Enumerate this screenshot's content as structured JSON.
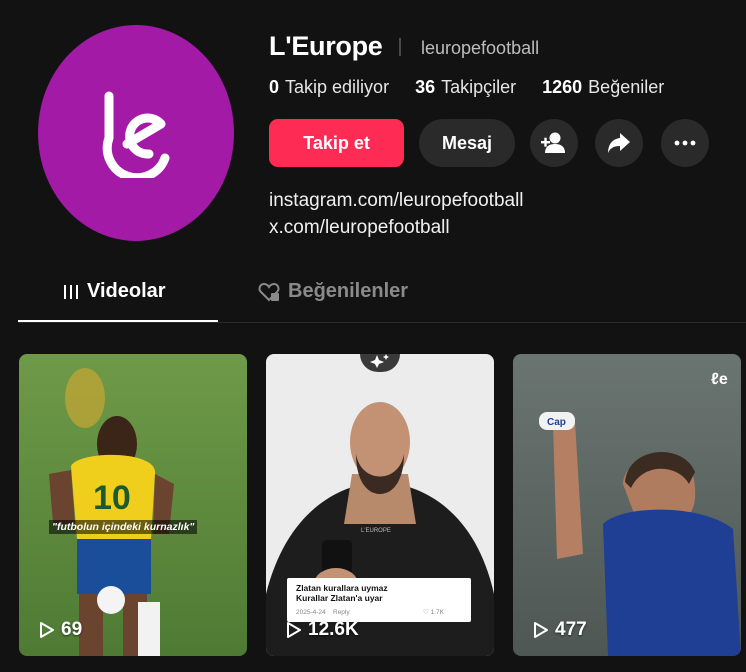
{
  "profile": {
    "name": "L'Europe",
    "handle": "leuropefootball",
    "avatar_color": "#a21aa6",
    "stats": [
      {
        "value": "0",
        "label": "Takip ediliyor"
      },
      {
        "value": "36",
        "label": "Takipçiler"
      },
      {
        "value": "1260",
        "label": "Beğeniler"
      }
    ],
    "links": [
      "instagram.com/leuropefootball",
      "x.com/leuropefootball"
    ]
  },
  "actions": {
    "follow_label": "Takip et",
    "message_label": "Mesaj",
    "icons": [
      "add-friend-icon",
      "share-icon",
      "more-icon"
    ],
    "follow_color": "#fe2c55"
  },
  "tabs": {
    "videos": "Videolar",
    "liked": "Beğenilenler"
  },
  "videos": [
    {
      "views": "69",
      "caption": "\"futbolun içindeki kurnazlık\""
    },
    {
      "views": "12.6K",
      "card_title": "Zlatan kurallara uymaz\nKurallar Zlatan'a uyar",
      "card_date": "2025-4-24",
      "card_reply": "Reply",
      "card_likes": "1.7K"
    },
    {
      "views": "477"
    }
  ]
}
